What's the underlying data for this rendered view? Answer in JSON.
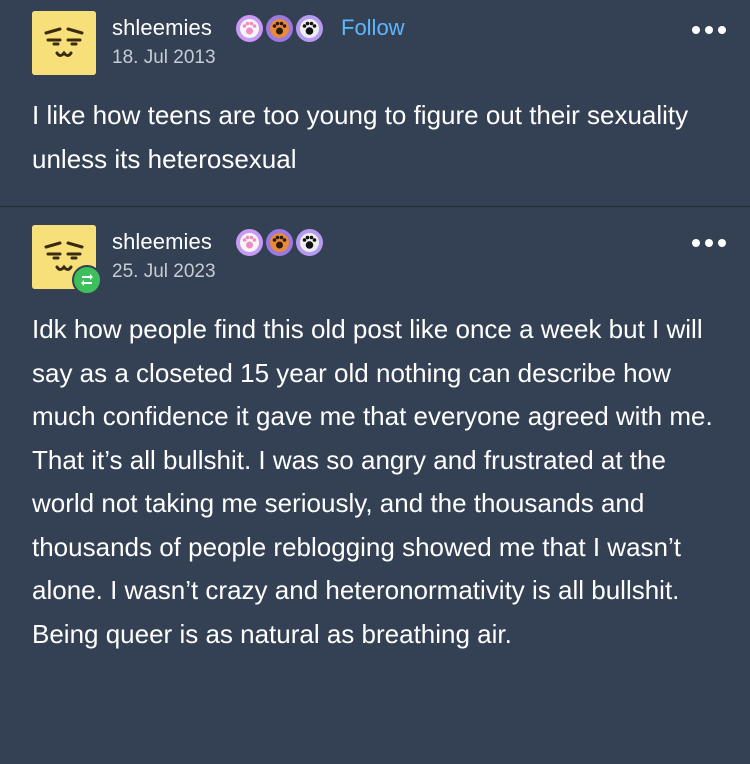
{
  "posts": [
    {
      "username": "shleemies",
      "follow_label": "Follow",
      "date": "18. Jul 2013",
      "text": "I like how teens are too young to figure out their sexuality unless its heterosexual",
      "badges": [
        "paw-badge-pink",
        "paw-badge-orange",
        "paw-badge-black"
      ]
    },
    {
      "username": "shleemies",
      "date": "25. Jul 2023",
      "text": "Idk how people find this old post like once a week but I will say as a closeted 15 year old nothing can describe how much confidence it gave me that everyone agreed with me. That it’s all bullshit. I was so angry and frustrated at the world not taking me seriously, and the thousands and thousands of people reblogging showed me that I wasn’t alone. I wasn’t crazy and heteronormativity is all bullshit. Being queer is as natural as breathing air.",
      "badges": [
        "paw-badge-pink",
        "paw-badge-orange",
        "paw-badge-black"
      ],
      "reblog_icon": "reblog-icon"
    }
  ],
  "colors": {
    "background": "#344154",
    "follow": "#5bb7ff",
    "avatar": "#f7df7a",
    "reblog_badge": "#3dbf5c"
  }
}
